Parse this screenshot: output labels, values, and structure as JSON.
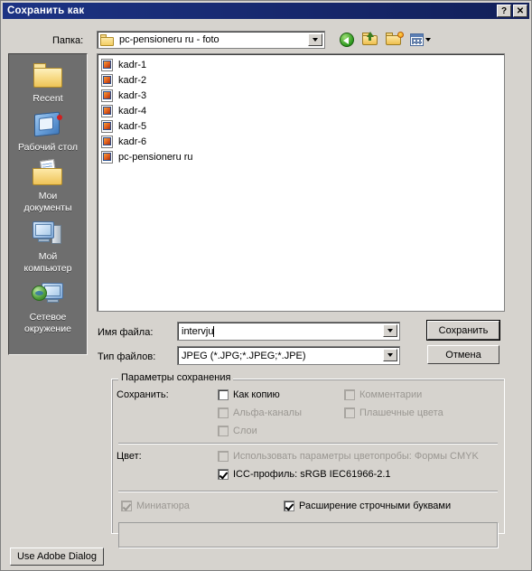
{
  "window": {
    "title": "Сохранить как",
    "help_button": "?",
    "close_button": "✕"
  },
  "toolbar": {
    "look_in_label": "Папка:",
    "current_folder": "pc-pensioneru ru - foto",
    "icons": [
      {
        "name": "back-icon",
        "title": "Назад"
      },
      {
        "name": "up-one-level-icon",
        "title": "Вверх"
      },
      {
        "name": "new-folder-icon",
        "title": "Создать папку"
      },
      {
        "name": "views-icon",
        "title": "Виды"
      }
    ]
  },
  "places_bar": {
    "items": [
      {
        "label": "Recent",
        "icon": "recent-folder-icon"
      },
      {
        "label": "Рабочий стол",
        "icon": "desktop-icon"
      },
      {
        "label": "Мои\nдокументы",
        "icon": "my-documents-icon"
      },
      {
        "label": "Мой\nкомпьютер",
        "icon": "my-computer-icon"
      },
      {
        "label": "Сетевое\nокружение",
        "icon": "network-places-icon"
      }
    ],
    "labels": {
      "recent": "Recent",
      "desktop": "Рабочий стол",
      "documents_line1": "Мои",
      "documents_line2": "документы",
      "computer_line1": "Мой",
      "computer_line2": "компьютер",
      "network_line1": "Сетевое",
      "network_line2": "окружение"
    }
  },
  "file_list": {
    "files": [
      {
        "name": "kadr-1",
        "icon": "image-file-icon"
      },
      {
        "name": "kadr-2",
        "icon": "image-file-icon"
      },
      {
        "name": "kadr-3",
        "icon": "image-file-icon"
      },
      {
        "name": "kadr-4",
        "icon": "image-file-icon"
      },
      {
        "name": "kadr-5",
        "icon": "image-file-icon"
      },
      {
        "name": "kadr-6",
        "icon": "image-file-icon"
      },
      {
        "name": "pc-pensioneru ru",
        "icon": "image-file-icon"
      }
    ]
  },
  "form": {
    "file_name_label": "Имя файла:",
    "file_name_value": "intervju",
    "file_type_label": "Тип файлов:",
    "file_type_value": "JPEG (*.JPG;*.JPEG;*.JPE)",
    "save_button": "Сохранить",
    "cancel_button": "Отмена"
  },
  "options": {
    "group_title": "Параметры сохранения",
    "save_label": "Сохранить:",
    "color_label": "Цвет:",
    "checkboxes": {
      "as_copy": {
        "label": "Как копию",
        "checked": false,
        "disabled": false
      },
      "comments": {
        "label": "Комментарии",
        "checked": false,
        "disabled": true
      },
      "alpha_channels": {
        "label": "Альфа-каналы",
        "checked": false,
        "disabled": true
      },
      "spot_colors": {
        "label": "Плашечные цвета",
        "checked": false,
        "disabled": true
      },
      "layers": {
        "label": "Слои",
        "checked": false,
        "disabled": true
      },
      "use_proof_setup": {
        "label": "Использовать параметры цветопробы:  Формы CMYK",
        "checked": false,
        "disabled": true
      },
      "icc_profile": {
        "label": "ICC-профиль:  sRGB IEC61966-2.1",
        "checked": true,
        "disabled": false
      },
      "thumbnail": {
        "label": "Миниатюра",
        "checked": true,
        "disabled": true
      },
      "lowercase_extension": {
        "label": "Расширение строчными буквами",
        "checked": true,
        "disabled": false
      }
    }
  },
  "footer": {
    "use_adobe_dialog_button": "Use Adobe Dialog"
  },
  "colors": {
    "titlebar_start": "#1c3384",
    "titlebar_end": "#122059",
    "dialog_face": "#d6d3ce",
    "places_bar": "#6e6e6e",
    "field_bg": "#ffffff",
    "disabled_text": "#9a9792"
  }
}
